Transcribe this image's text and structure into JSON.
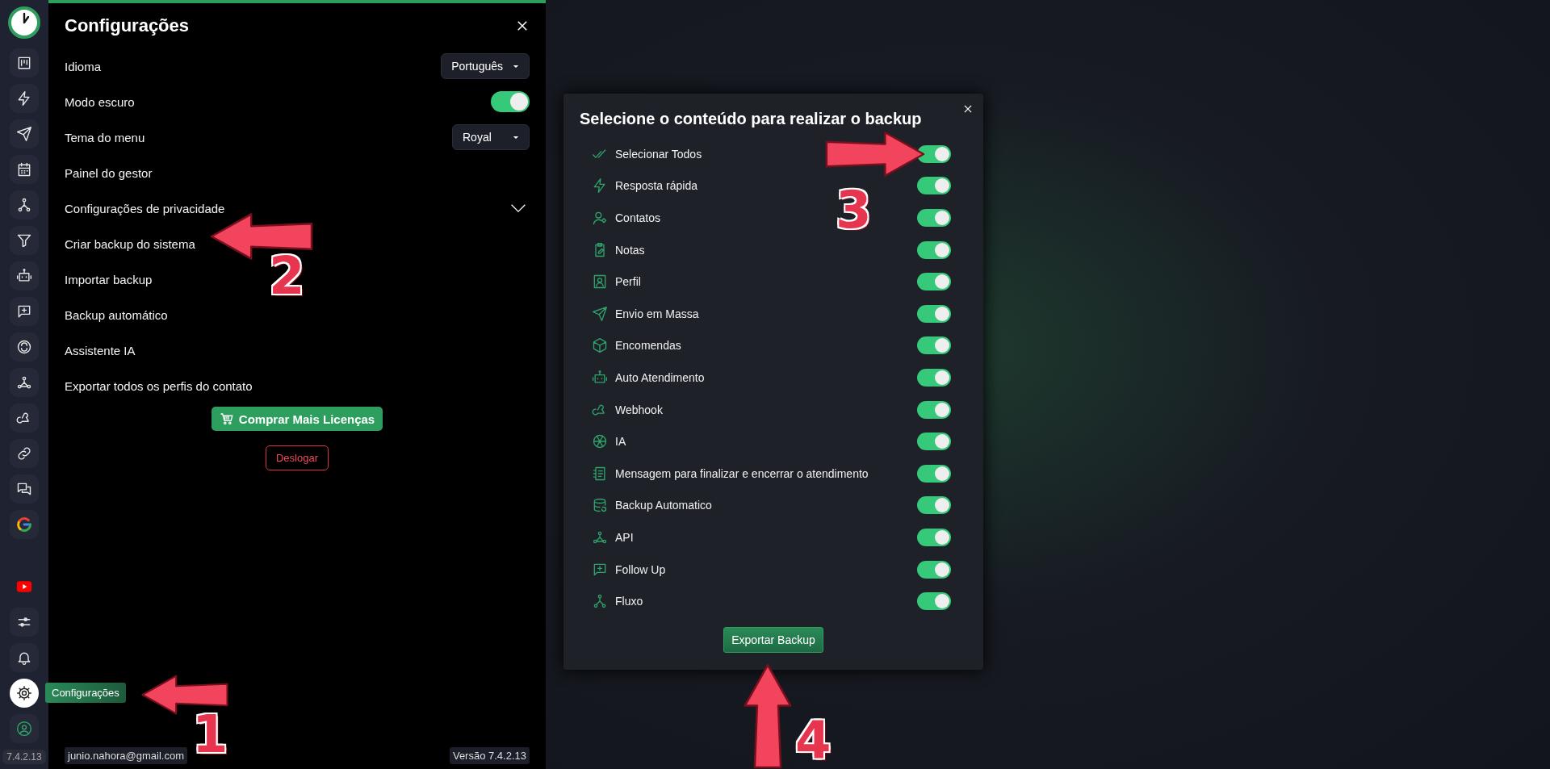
{
  "sidebar": {
    "top_items": [
      {
        "selected": false
      },
      {
        "selected": false
      },
      {
        "selected": false
      },
      {
        "selected": false
      },
      {
        "selected": false
      },
      {
        "selected": false
      },
      {
        "selected": false
      },
      {
        "selected": false
      },
      {
        "selected": false
      },
      {
        "selected": false
      },
      {
        "selected": false
      },
      {
        "selected": false
      },
      {
        "selected": false
      },
      {
        "selected": false
      }
    ],
    "bottom_items": [
      {
        "selected": false
      },
      {
        "selected": false
      },
      {
        "selected": false
      },
      {
        "selected": true
      },
      {
        "selected": false
      }
    ],
    "tooltip": "Configurações",
    "version": "7.4.2.13"
  },
  "settings": {
    "title": "Configurações",
    "rows": [
      {
        "kind": "select",
        "label": "Idioma",
        "value": "Português"
      },
      {
        "kind": "toggle",
        "label": "Modo escuro",
        "on": true
      },
      {
        "kind": "select",
        "label": "Tema do menu",
        "value": "Royal"
      },
      {
        "kind": "link",
        "label": "Painel do gestor"
      },
      {
        "kind": "expander",
        "label": "Configurações de privacidade",
        "expanded": false
      },
      {
        "kind": "link",
        "label": "Criar backup do sistema"
      },
      {
        "kind": "link",
        "label": "Importar backup"
      },
      {
        "kind": "link",
        "label": "Backup automático"
      },
      {
        "kind": "link",
        "label": "Assistente IA"
      },
      {
        "kind": "link",
        "label": "Exportar todos os perfis do contato"
      }
    ],
    "buy_button": "Comprar Mais Licenças",
    "logout_button": "Deslogar",
    "email": "junio.nahora@gmail.com",
    "version": "Versão 7.4.2.13"
  },
  "modal": {
    "title": "Selecione o conteúdo para realizar o backup",
    "items": [
      {
        "label": "Selecionar Todos",
        "on": true
      },
      {
        "label": "Resposta rápida",
        "on": true
      },
      {
        "label": "Contatos",
        "on": true
      },
      {
        "label": "Notas",
        "on": true
      },
      {
        "label": "Perfil",
        "on": true
      },
      {
        "label": "Envio em Massa",
        "on": true
      },
      {
        "label": "Encomendas",
        "on": true
      },
      {
        "label": "Auto Atendimento",
        "on": true
      },
      {
        "label": "Webhook",
        "on": true
      },
      {
        "label": "IA",
        "on": true
      },
      {
        "label": "Mensagem para finalizar e encerrar o atendimento",
        "on": true
      },
      {
        "label": "Backup Automatico",
        "on": true
      },
      {
        "label": "API",
        "on": true
      },
      {
        "label": "Follow Up",
        "on": true
      },
      {
        "label": "Fluxo",
        "on": true
      }
    ],
    "export_button": "Exportar Backup"
  },
  "annotations": [
    {
      "number": "1"
    },
    {
      "number": "2"
    },
    {
      "number": "3"
    },
    {
      "number": "4"
    }
  ]
}
